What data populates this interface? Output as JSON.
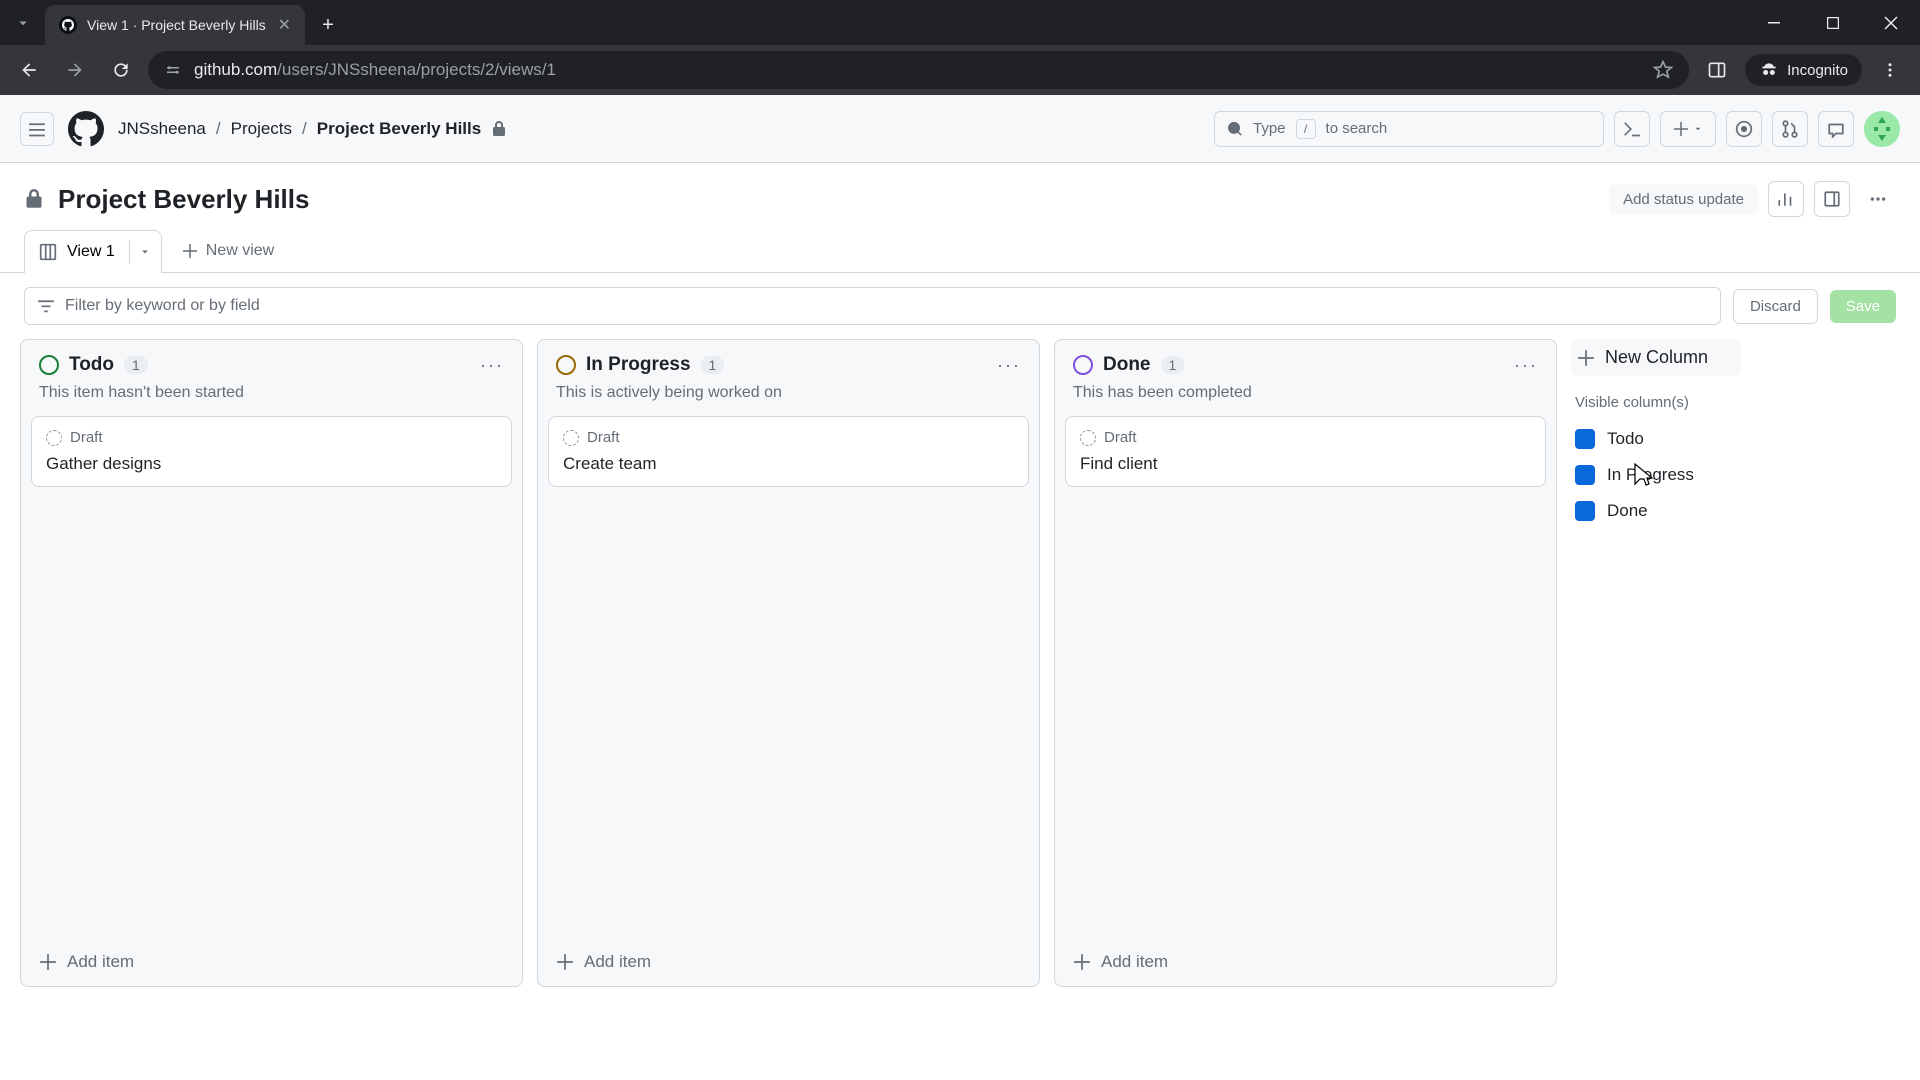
{
  "browser": {
    "tab_title": "View 1 · Project Beverly Hills",
    "url_display_prefix": "github.com",
    "url_display_rest": "/users/JNSsheena/projects/2/views/1",
    "incognito_label": "Incognito"
  },
  "header": {
    "breadcrumb_user": "JNSsheena",
    "breadcrumb_projects": "Projects",
    "breadcrumb_current": "Project Beverly Hills",
    "search_placeholder_pre": "Type",
    "search_placeholder_key": "/",
    "search_placeholder_post": "to search"
  },
  "project": {
    "title": "Project Beverly Hills",
    "status_update_label": "Add status update"
  },
  "views": {
    "active_view": "View 1",
    "new_view_label": "New view"
  },
  "filter": {
    "placeholder": "Filter by keyword or by field",
    "discard_label": "Discard",
    "save_label": "Save"
  },
  "columns": [
    {
      "name": "Todo",
      "count": "1",
      "description": "This item hasn't been started",
      "color_class": "status-green",
      "cards": [
        {
          "draft_label": "Draft",
          "title": "Gather designs"
        }
      ],
      "add_label": "Add item"
    },
    {
      "name": "In Progress",
      "count": "1",
      "description": "This is actively being worked on",
      "color_class": "status-yellow",
      "cards": [
        {
          "draft_label": "Draft",
          "title": "Create team"
        }
      ],
      "add_label": "Add item"
    },
    {
      "name": "Done",
      "count": "1",
      "description": "This has been completed",
      "color_class": "status-purple",
      "cards": [
        {
          "draft_label": "Draft",
          "title": "Find client"
        }
      ],
      "add_label": "Add item"
    }
  ],
  "newcol": {
    "button_label": "New Column",
    "visible_label": "Visible column(s)",
    "items": [
      "Todo",
      "In Progress",
      "Done"
    ]
  }
}
